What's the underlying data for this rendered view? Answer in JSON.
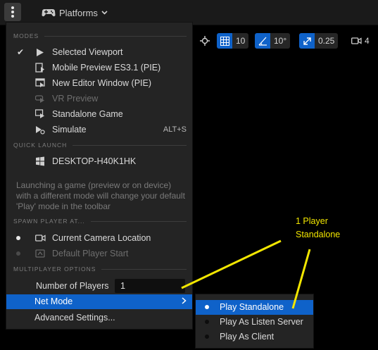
{
  "toolbar": {
    "platforms_label": "Platforms"
  },
  "viewport_tools": {
    "grid_value": "10",
    "angle_value": "10°",
    "scale_value": "0.25",
    "camera_value": "4"
  },
  "menu": {
    "modes_header": "MODES",
    "modes": [
      {
        "label": "Selected Viewport",
        "checked": true,
        "disabled": false,
        "icon": "play-icon"
      },
      {
        "label": "Mobile Preview ES3.1 (PIE)",
        "checked": false,
        "disabled": false,
        "icon": "mobile-preview-icon"
      },
      {
        "label": "New Editor Window (PIE)",
        "checked": false,
        "disabled": false,
        "icon": "new-window-icon"
      },
      {
        "label": "VR Preview",
        "checked": false,
        "disabled": true,
        "icon": "vr-preview-icon"
      },
      {
        "label": "Standalone Game",
        "checked": false,
        "disabled": false,
        "icon": "standalone-icon"
      },
      {
        "label": "Simulate",
        "checked": false,
        "disabled": false,
        "icon": "simulate-icon",
        "shortcut": "ALT+S"
      }
    ],
    "quick_launch_header": "QUICK LAUNCH",
    "quick_launch_device": "DESKTOP-H40K1HK",
    "description": "Launching a game (preview or on device) with a different mode will change your default 'Play' mode in the toolbar",
    "spawn_header": "SPAWN PLAYER AT...",
    "spawn_options": [
      {
        "label": "Current Camera Location",
        "selected": true,
        "disabled": false
      },
      {
        "label": "Default Player Start",
        "selected": false,
        "disabled": true
      }
    ],
    "multiplayer_header": "MULTIPLAYER OPTIONS",
    "number_of_players_label": "Number of Players",
    "number_of_players_value": "1",
    "net_mode_label": "Net Mode",
    "advanced_settings_label": "Advanced Settings..."
  },
  "net_mode_submenu": {
    "options": [
      {
        "label": "Play Standalone",
        "selected": true
      },
      {
        "label": "Play As Listen Server",
        "selected": false
      },
      {
        "label": "Play As Client",
        "selected": false
      }
    ]
  },
  "annotation": {
    "line1": "1 Player",
    "line2": "Standalone"
  },
  "colors": {
    "accent": "#0f62c9",
    "annotation": "#f2e600",
    "menu_bg": "#242424"
  }
}
